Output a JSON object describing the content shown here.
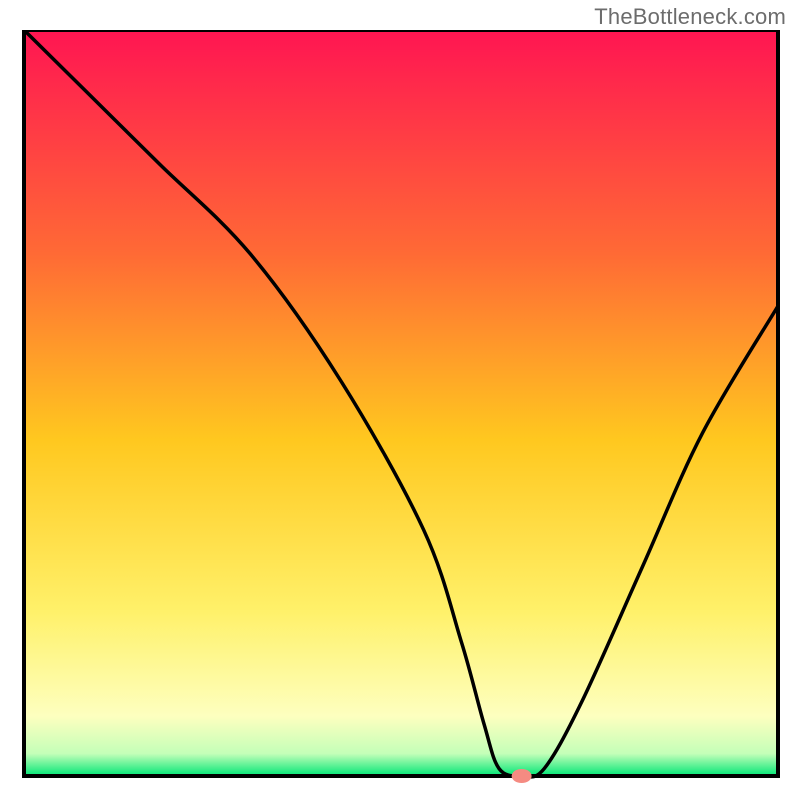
{
  "watermark": "TheBottleneck.com",
  "chart_data": {
    "type": "line",
    "title": "",
    "xlabel": "",
    "ylabel": "",
    "xlim": [
      0,
      100
    ],
    "ylim": [
      0,
      100
    ],
    "background": {
      "type": "vertical-gradient",
      "stops": [
        {
          "offset": 0.0,
          "color": "#ff1552"
        },
        {
          "offset": 0.3,
          "color": "#ff6a35"
        },
        {
          "offset": 0.55,
          "color": "#ffc81f"
        },
        {
          "offset": 0.78,
          "color": "#fff16a"
        },
        {
          "offset": 0.92,
          "color": "#fdffbf"
        },
        {
          "offset": 0.97,
          "color": "#c4ffb8"
        },
        {
          "offset": 1.0,
          "color": "#00e676"
        }
      ]
    },
    "series": [
      {
        "name": "bottleneck-curve",
        "color": "#000000",
        "x": [
          0,
          8,
          18,
          30,
          42,
          53,
          58,
          61,
          63,
          66,
          69,
          74,
          82,
          90,
          100
        ],
        "y": [
          100,
          92,
          82,
          70,
          53,
          33,
          18,
          7,
          1,
          0,
          1,
          10,
          28,
          46,
          63
        ]
      }
    ],
    "marker": {
      "name": "optimal-point",
      "x": 66,
      "y": 0,
      "color": "#f58b82",
      "rx": 10,
      "ry": 7
    }
  }
}
